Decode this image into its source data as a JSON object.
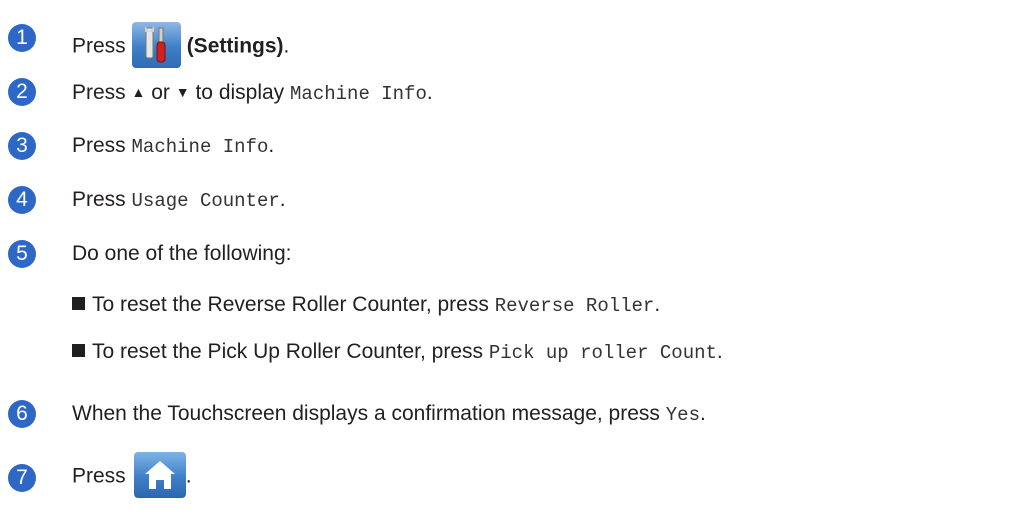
{
  "steps": [
    {
      "num": "1",
      "press": "Press",
      "settings_label": "(Settings)",
      "period": "."
    },
    {
      "num": "2",
      "press": "Press",
      "up_arrow": "▲",
      "or": "or",
      "down_arrow": "▼",
      "to_display": "to display",
      "value": "Machine Info",
      "period": "."
    },
    {
      "num": "3",
      "press": "Press",
      "value": "Machine Info",
      "period": "."
    },
    {
      "num": "4",
      "press": "Press",
      "value": "Usage Counter",
      "period": "."
    },
    {
      "num": "5",
      "text": "Do one of the following:",
      "bullets": [
        {
          "text": "To reset the Reverse Roller Counter, press",
          "value": "Reverse Roller",
          "period": "."
        },
        {
          "text": "To reset the Pick Up Roller Counter, press",
          "value": "Pick up roller Count",
          "period": "."
        }
      ]
    },
    {
      "num": "6",
      "text": "When the Touchscreen displays a confirmation message, press",
      "value": "Yes",
      "period": "."
    },
    {
      "num": "7",
      "press": "Press",
      "period": "."
    }
  ],
  "icons": {
    "settings": "settings-tools-icon",
    "home": "home-icon"
  },
  "colors": {
    "step_badge": "#2d68c7",
    "button_blue": "#3e7fc8"
  }
}
